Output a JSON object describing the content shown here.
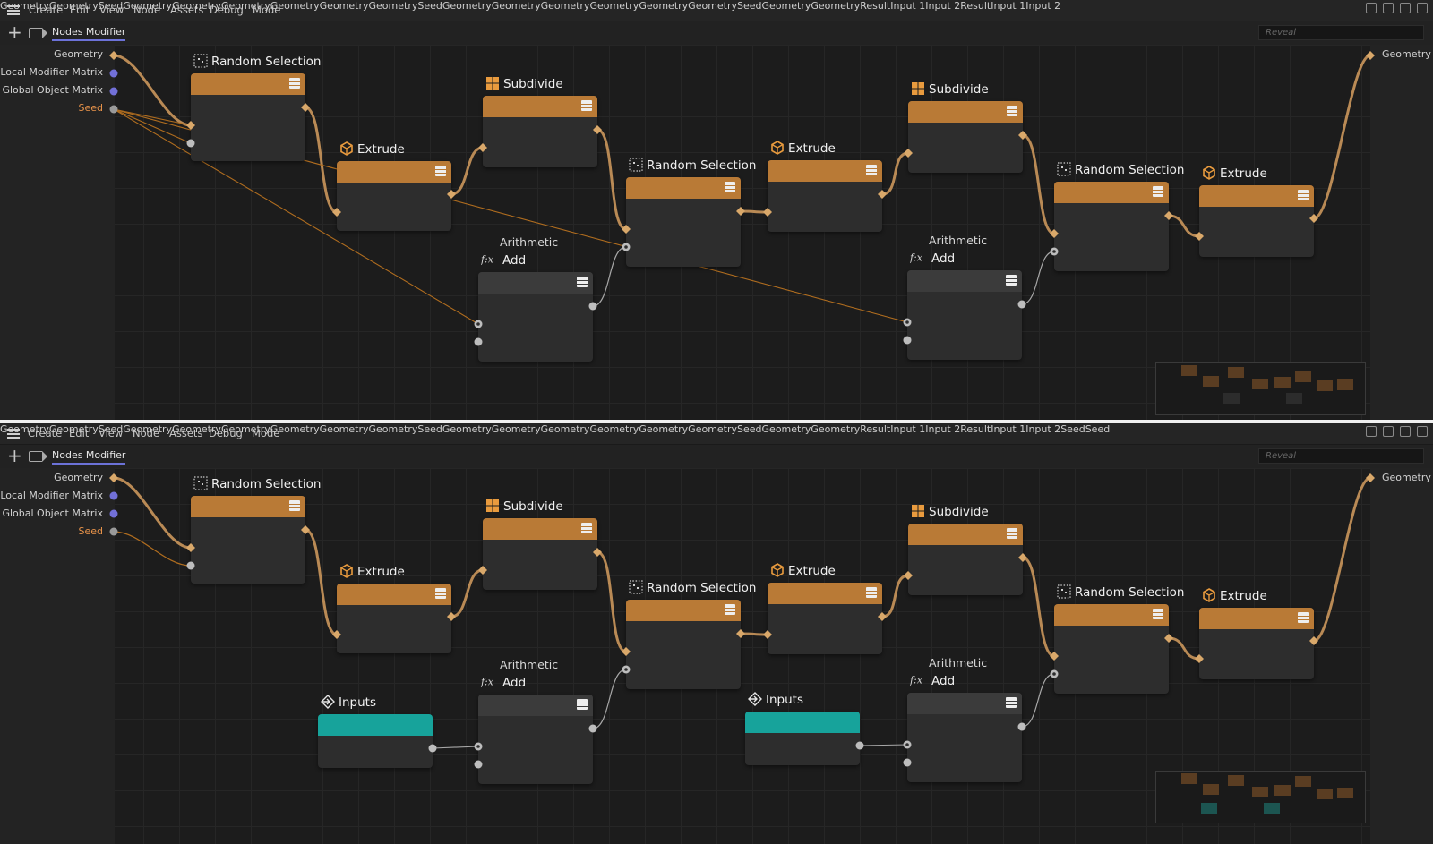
{
  "menu": {
    "items": [
      "Create",
      "Edit",
      "View",
      "Node",
      "Assets",
      "Debug",
      "Mode"
    ]
  },
  "tab": {
    "label": "Nodes Modifier"
  },
  "search": {
    "placeholder": "Reveal"
  },
  "colors": {
    "node_header": "#b97a36",
    "inputs_header": "#17a39b",
    "wire": "#c8a27a",
    "accent_tab": "#6c72d8",
    "seed_label": "#e8934a"
  },
  "left_ports": [
    "Geometry",
    "Local Modifier Matrix",
    "Global Object Matrix",
    "Seed"
  ],
  "right_port": "Geometry",
  "labels": {
    "geometry": "Geometry",
    "seed": "Seed",
    "result": "Result",
    "input1": "Input 1",
    "input2": "Input 2",
    "arithmetic": "Arithmetic"
  },
  "node_titles": {
    "random_selection": "Random Selection",
    "extrude": "Extrude",
    "subdivide": "Subdivide",
    "add": "Add",
    "inputs": "Inputs"
  },
  "icons": [
    "hamburger-menu-icon",
    "plus-icon",
    "tag-icon",
    "random-selection-icon",
    "extrude-cube-icon",
    "subdivide-grid-icon",
    "fx-icon",
    "inputs-arrow-icon",
    "panel-left-icon",
    "panel-right-icon",
    "lock-icon",
    "maximize-icon"
  ]
}
